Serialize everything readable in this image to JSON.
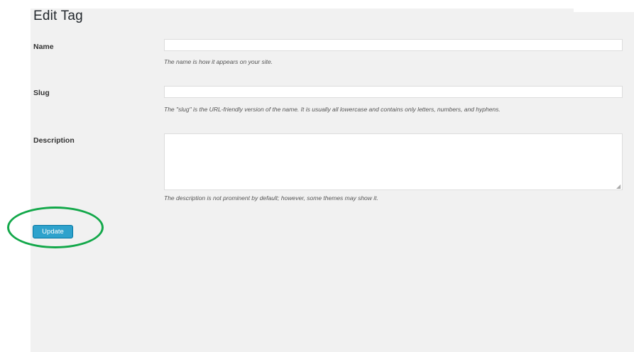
{
  "page": {
    "title": "Edit Tag"
  },
  "form": {
    "name": {
      "label": "Name",
      "value": "",
      "hint": "The name is how it appears on your site."
    },
    "slug": {
      "label": "Slug",
      "value": "",
      "hint": "The \"slug\" is the URL-friendly version of the name. It is usually all lowercase and contains only letters, numbers, and hyphens."
    },
    "description": {
      "label": "Description",
      "value": "",
      "hint": "The description is not prominent by default; however, some themes may show it."
    },
    "submit_label": "Update"
  },
  "colors": {
    "panel_bg": "#f1f1f1",
    "button_blue": "#2ea2cc",
    "highlight_ring": "#13a84a"
  },
  "annotation": {
    "type": "green-ellipse",
    "target": "update-button"
  }
}
